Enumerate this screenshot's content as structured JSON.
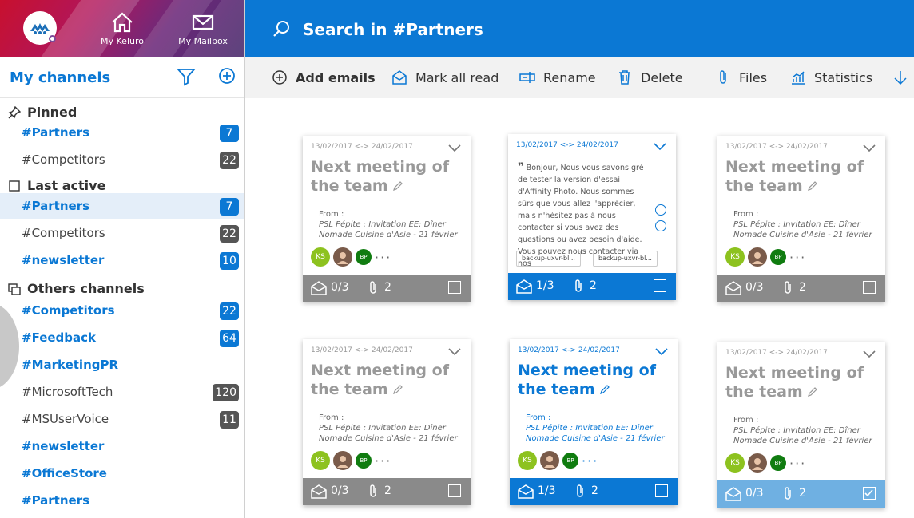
{
  "header": {
    "nav": [
      {
        "label": "My Keluro",
        "icon": "home-icon"
      },
      {
        "label": "My Mailbox",
        "icon": "mail-icon"
      }
    ],
    "search_text": "Search in #Partners"
  },
  "sidebar": {
    "title": "My channels",
    "sections": [
      {
        "label": "Pinned",
        "icon": "pin-icon"
      },
      {
        "label": "Last active",
        "icon": "square-icon"
      },
      {
        "label": "Others channels",
        "icon": "channels-icon"
      }
    ],
    "pinned": [
      {
        "name": "#Partners",
        "badge": "7"
      },
      {
        "name": "#Competitors",
        "badge": "22"
      }
    ],
    "last_active": [
      {
        "name": "#Partners",
        "badge": "7"
      },
      {
        "name": "#Competitors",
        "badge": "22"
      },
      {
        "name": "#newsletter",
        "badge": "10"
      }
    ],
    "others": [
      {
        "name": "#Competitors",
        "badge": "22"
      },
      {
        "name": "#Feedback",
        "badge": "64"
      },
      {
        "name": "#MarketingPR",
        "badge": ""
      },
      {
        "name": "#MicrosoftTech",
        "badge": "120"
      },
      {
        "name": "#MSUserVoice",
        "badge": "11"
      },
      {
        "name": "#newsletter",
        "badge": ""
      },
      {
        "name": "#OfficeStore",
        "badge": ""
      },
      {
        "name": "#Partners",
        "badge": ""
      }
    ]
  },
  "toolbar": {
    "add_emails": "Add emails",
    "mark_all_read": "Mark all read",
    "rename": "Rename",
    "delete": "Delete",
    "files": "Files",
    "statistics": "Statistics"
  },
  "cards": [
    {
      "date": "13/02/2017 <-> 24/02/2017",
      "title": "Next meeting of the team",
      "from_label": "From :",
      "from_line1": "PSL Pépite : Invitation EE: Dîner",
      "from_line2": "Nomade Cuisine d'Asie - 21 février",
      "read": "0/3",
      "attachments": "2"
    },
    {
      "date": "13/02/2017 <-> 24/02/2017",
      "quote": "Bonjour, Nous vous savons gré de tester la version d'essai d'Affinity Photo. Nous sommes sûrs que vous allez l'apprécier, mais n'hésitez pas à nous contacter si vous avez des questions ou avez besoin d'aide. Vous pouvez nous contacter via nos",
      "att1": "backup-uxvr-bl...",
      "att2": "backup-uxvr-bl...",
      "read": "1/3",
      "attachments": "2"
    },
    {
      "date": "13/02/2017 <-> 24/02/2017",
      "title": "Next meeting of the team",
      "from_label": "From :",
      "from_line1": "PSL Pépite : Invitation EE: Dîner",
      "from_line2": "Nomade Cuisine d'Asie - 21 février",
      "read": "0/3",
      "attachments": "2"
    },
    {
      "date": "13/02/2017 <-> 24/02/2017",
      "title": "Next meeting of the team",
      "from_label": "From :",
      "from_line1": "PSL Pépite : Invitation EE: Dîner",
      "from_line2": "Nomade Cuisine d'Asie - 21 février",
      "read": "0/3",
      "attachments": "2"
    },
    {
      "date": "13/02/2017 <-> 24/02/2017",
      "title": "Next meeting of the team",
      "from_label": "From :",
      "from_line1": "PSL Pépite : Invitation EE: Dîner",
      "from_line2": "Nomade Cuisine d'Asie - 21 février",
      "read": "1/3",
      "attachments": "2"
    },
    {
      "date": "13/02/2017 <-> 24/02/2017",
      "title": "Next meeting of the team",
      "from_label": "From :",
      "from_line1": "PSL Pépite : Invitation EE: Dîner",
      "from_line2": "Nomade Cuisine d'Asie - 21 février",
      "read": "0/3",
      "attachments": "2"
    }
  ],
  "avatars": {
    "ks": "KS",
    "bp": "BP",
    "more": "···"
  },
  "colors": {
    "accent": "#0b78d4",
    "badge_grey": "#555555",
    "footer_grey": "#8a8a8a",
    "footer_checked": "#6fb0e2"
  }
}
